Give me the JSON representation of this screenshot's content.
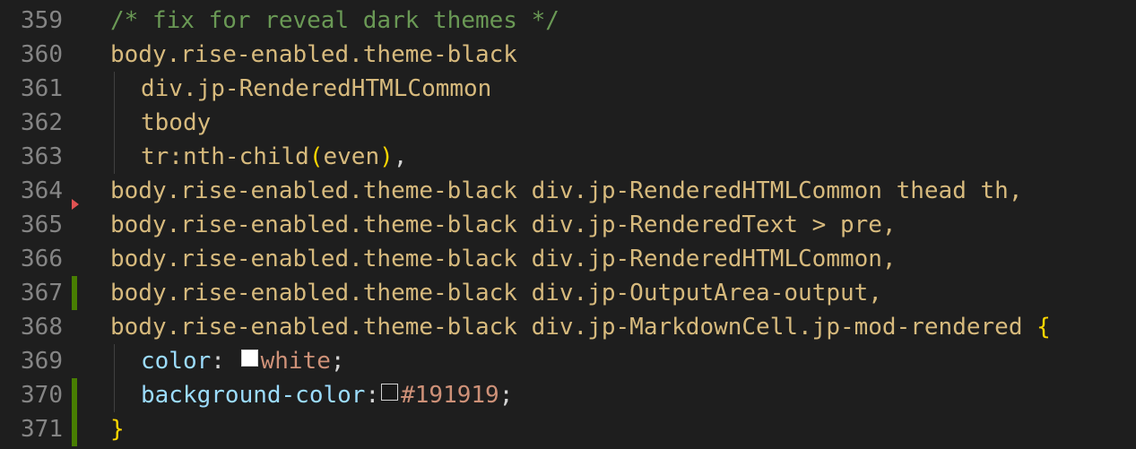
{
  "colors": {
    "background": "#1e1e1e",
    "comment": "#6a9955",
    "selector": "#d7ba7d",
    "property": "#9cdcfe",
    "value": "#ce9178",
    "brace": "#ffd700",
    "line_number": "#858585",
    "added_marker": "#487e02",
    "deleted_marker": "#e05252"
  },
  "lines": [
    {
      "num": "359",
      "text": "/* fix for reveal dark themes */"
    },
    {
      "num": "360",
      "text": "body.rise-enabled.theme-black"
    },
    {
      "num": "361",
      "text": "div.jp-RenderedHTMLCommon"
    },
    {
      "num": "362",
      "text": "tbody"
    },
    {
      "num": "363",
      "sel": "tr:nth-child",
      "paren_open": "(",
      "arg": "even",
      "paren_close": ")",
      "tail": ","
    },
    {
      "num": "364",
      "text": "body.rise-enabled.theme-black div.jp-RenderedHTMLCommon thead th,"
    },
    {
      "num": "365",
      "text": "body.rise-enabled.theme-black div.jp-RenderedText > pre,"
    },
    {
      "num": "366",
      "text": "body.rise-enabled.theme-black div.jp-RenderedHTMLCommon,"
    },
    {
      "num": "367",
      "text": "body.rise-enabled.theme-black div.jp-OutputArea-output,"
    },
    {
      "num": "368",
      "text": "body.rise-enabled.theme-black div.jp-MarkdownCell.jp-mod-rendered ",
      "brace": "{"
    },
    {
      "num": "369",
      "prop": "color",
      "colon": ":",
      "value": "white",
      "semi": ";",
      "swatch": "#ffffff"
    },
    {
      "num": "370",
      "prop": "background-color",
      "colon": ":",
      "value": "#191919",
      "semi": ";",
      "swatch": "#191919"
    },
    {
      "num": "371",
      "brace": "}"
    }
  ]
}
